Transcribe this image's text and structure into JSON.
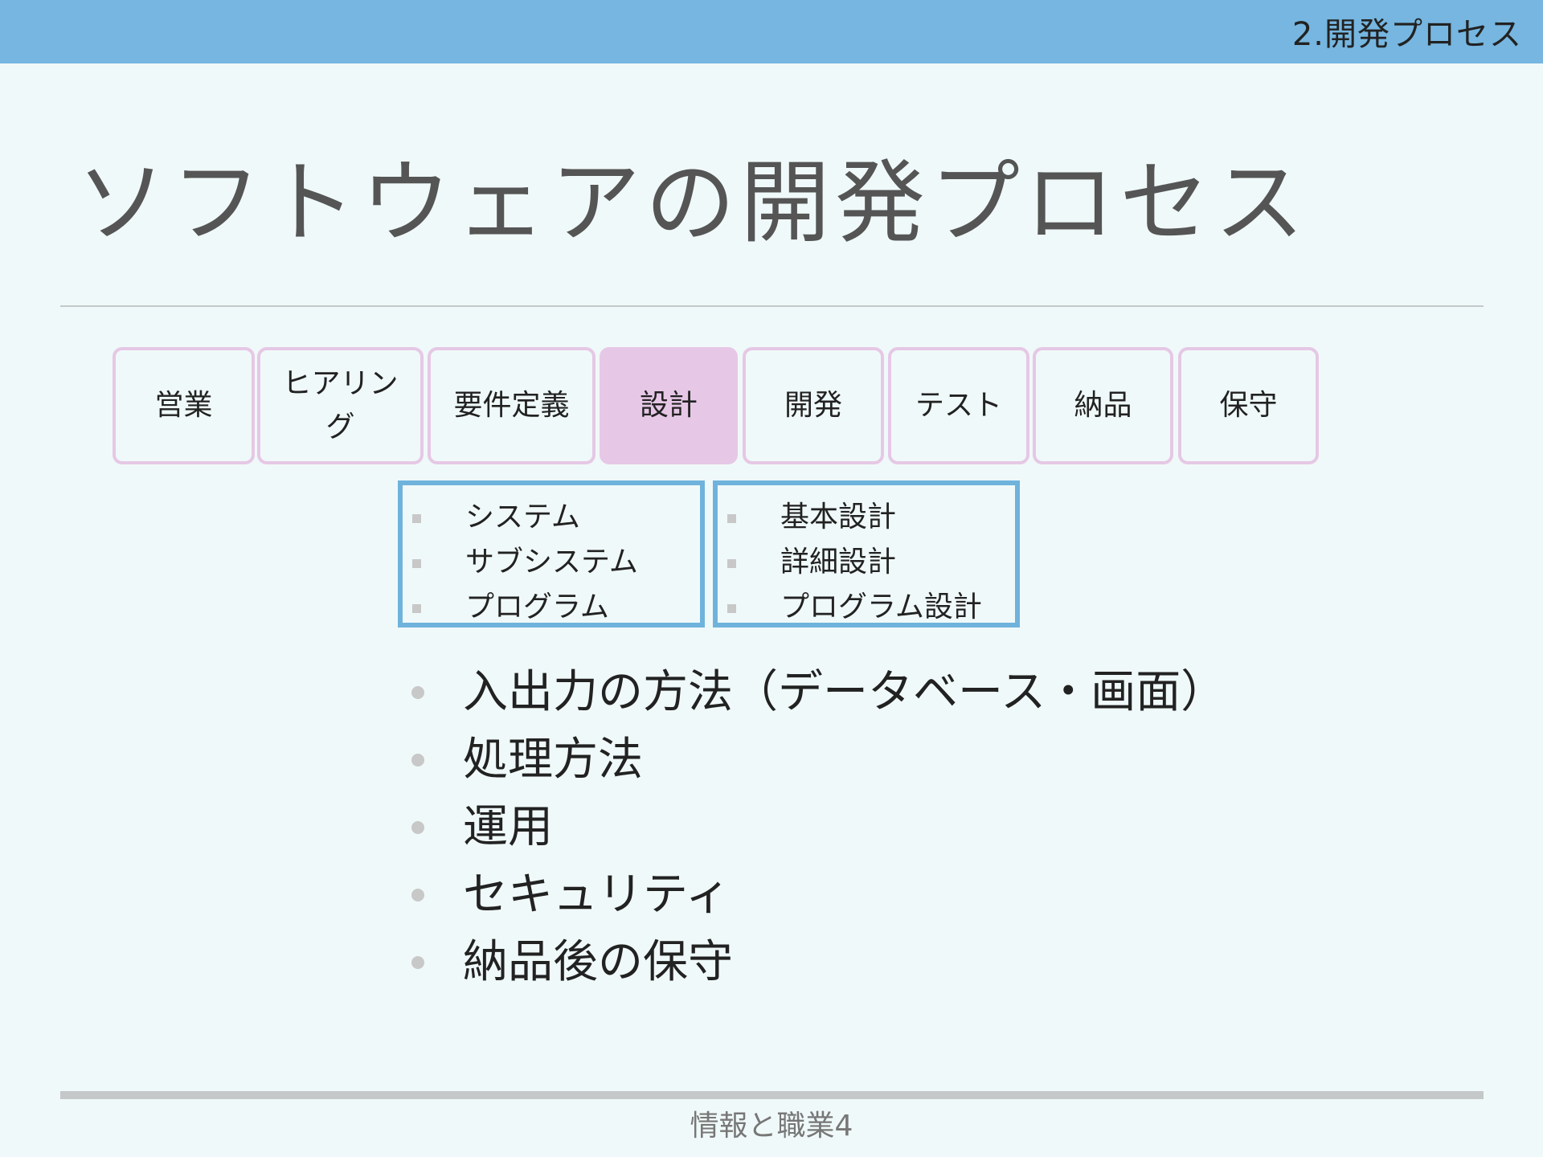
{
  "header": {
    "section_label": "2.開発プロセス"
  },
  "title": "ソフトウェアの開発プロセス",
  "process_steps": [
    {
      "label": "営業",
      "active": false
    },
    {
      "label": "ヒアリング",
      "active": false
    },
    {
      "label": "要件定義",
      "active": false
    },
    {
      "label": "設計",
      "active": true
    },
    {
      "label": "開発",
      "active": false
    },
    {
      "label": "テスト",
      "active": false
    },
    {
      "label": "納品",
      "active": false
    },
    {
      "label": "保守",
      "active": false
    }
  ],
  "design_scope_box": {
    "items": [
      "システム",
      "サブシステム",
      "プログラム"
    ]
  },
  "design_level_box": {
    "items": [
      "基本設計",
      "詳細設計",
      "プログラム設計"
    ]
  },
  "bullets": [
    "入出力の方法（データベース・画面）",
    "処理方法",
    "運用",
    "セキュリティ",
    "納品後の保守"
  ],
  "footer": {
    "text": "情報と職業4"
  },
  "colors": {
    "topbar": "#76b6e0",
    "background": "#f0f9f9",
    "step_border": "#e5c8e5",
    "step_active_fill": "#e6c8e6",
    "subbox_border": "#6fb3dc",
    "bullet_marker": "#c8c8c8"
  }
}
